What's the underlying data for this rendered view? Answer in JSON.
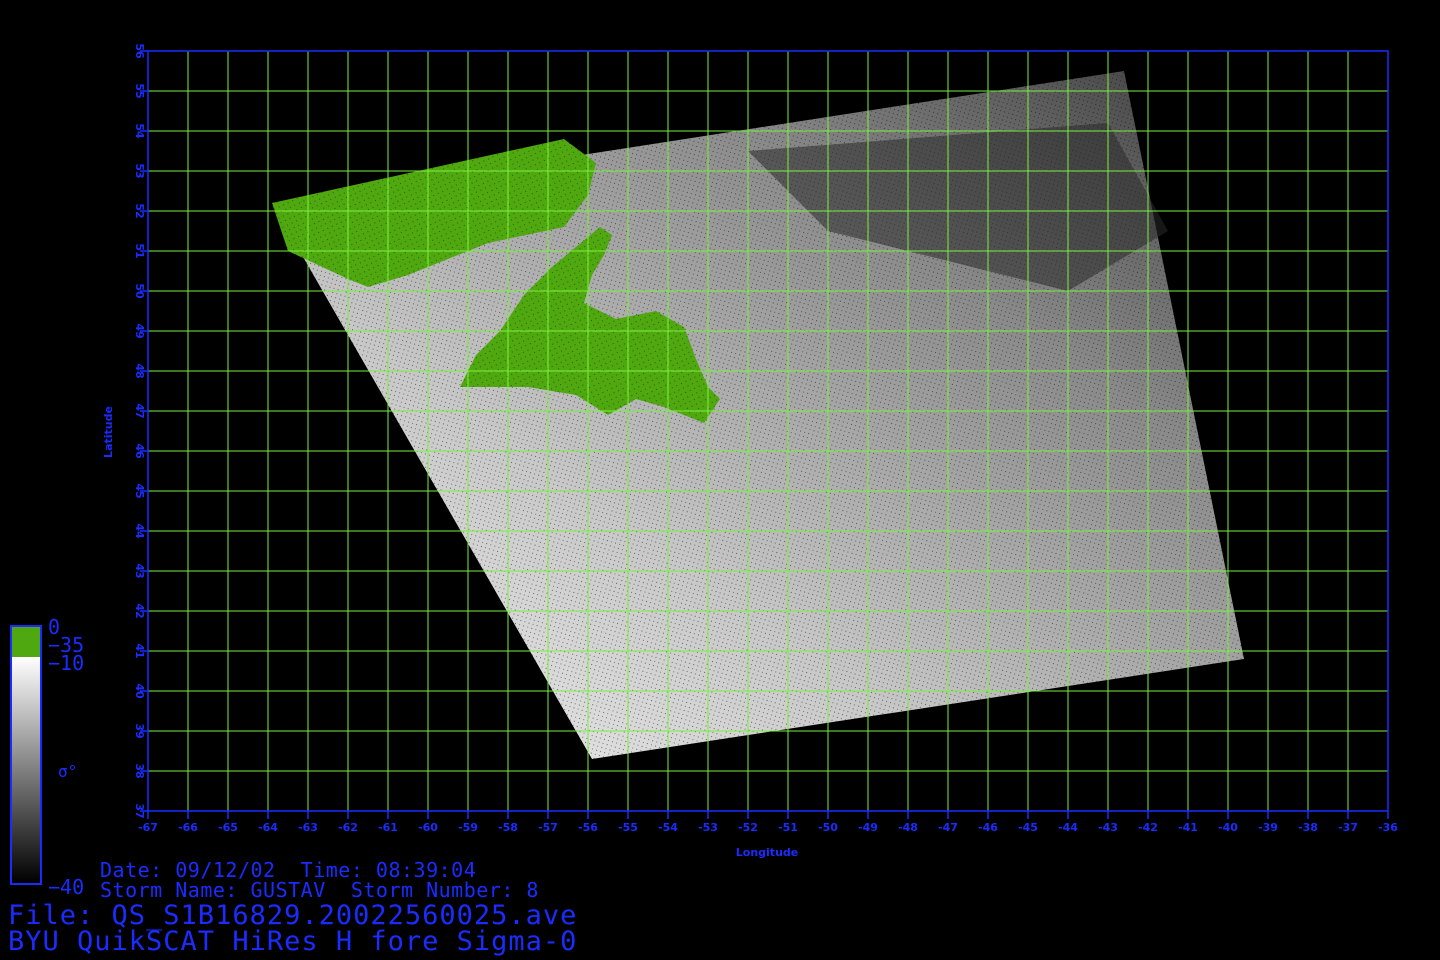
{
  "map": {
    "xlabel": "Longitude",
    "ylabel": "Latitude",
    "lon_range": [
      -67,
      -36
    ],
    "lat_range": [
      37,
      56
    ],
    "lon_ticks": [
      "-67",
      "-66",
      "-65",
      "-64",
      "-63",
      "-62",
      "-61",
      "-60",
      "-59",
      "-58",
      "-57",
      "-56",
      "-55",
      "-54",
      "-53",
      "-52",
      "-51",
      "-50",
      "-49",
      "-48",
      "-47",
      "-46",
      "-45",
      "-44",
      "-43",
      "-42",
      "-41",
      "-40",
      "-39",
      "-38",
      "-37",
      "-36"
    ],
    "lat_ticks": [
      "37",
      "38",
      "39",
      "40",
      "41",
      "42",
      "43",
      "44",
      "45",
      "46",
      "47",
      "48",
      "49",
      "50",
      "51",
      "52",
      "53",
      "54",
      "55",
      "56"
    ],
    "swath_corners_lonlat": [
      [
        -63.9,
        52.2
      ],
      [
        -42.6,
        55.5
      ],
      [
        -39.6,
        40.8
      ],
      [
        -55.9,
        38.3
      ]
    ],
    "grid_color": "#7cf03c",
    "axis_color": "#1a2cff",
    "land_color": "#4fa80f"
  },
  "colorbar": {
    "symbol": "σ°",
    "land_top": "0",
    "land_bottom": "−35",
    "top": "−10",
    "bottom": "−40"
  },
  "info": {
    "date_line": "Date: 09/12/02  Time: 08:39:04",
    "storm_line": "Storm Name: GUSTAV  Storm Number: 8",
    "file_line": "File: QS_S1B16829.20022560025.ave",
    "title_line": "BYU QuikSCAT HiRes H fore Sigma-0"
  }
}
